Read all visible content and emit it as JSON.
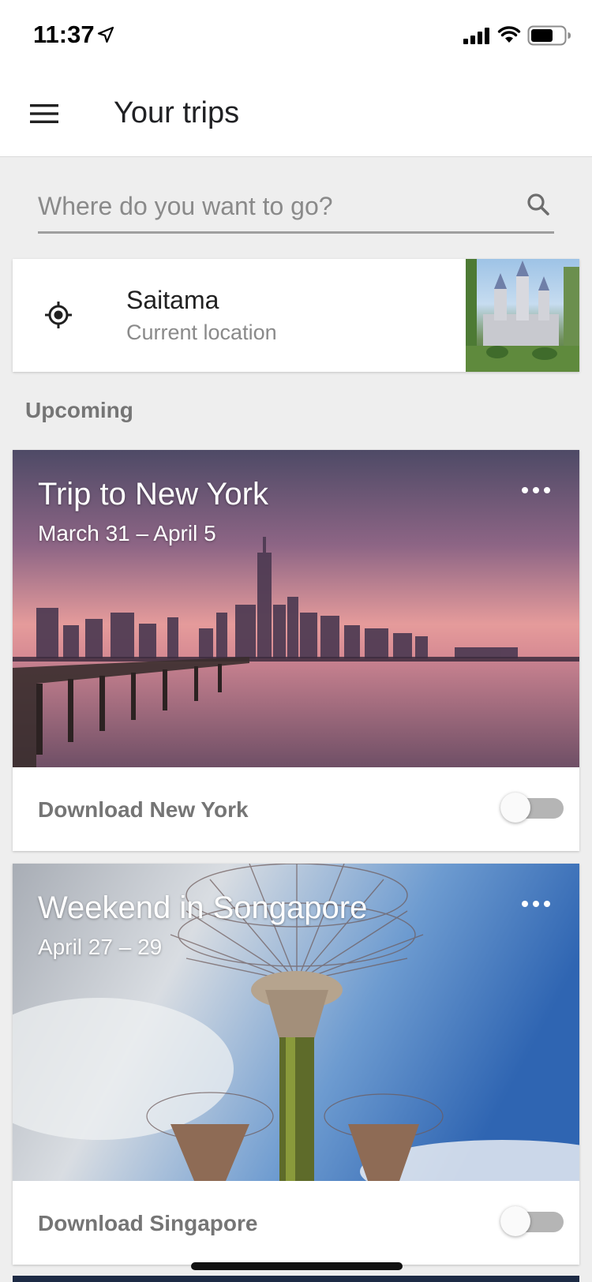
{
  "status_bar": {
    "time": "11:37",
    "icons": [
      "location-arrow-icon",
      "cellular-signal-icon",
      "wifi-icon",
      "battery-icon"
    ]
  },
  "app_bar": {
    "title": "Your trips",
    "menu_icon": "hamburger-menu-icon"
  },
  "search": {
    "placeholder": "Where do you want to go?",
    "value": "",
    "icon": "search-icon"
  },
  "location_card": {
    "name": "Saitama",
    "subtitle": "Current location",
    "icon": "target-icon"
  },
  "section": {
    "label": "Upcoming"
  },
  "trips": [
    {
      "title": "Trip to New York",
      "dates": "March 31 – April 5",
      "download_label": "Download New York",
      "download_enabled": false
    },
    {
      "title": "Weekend in Songapore",
      "dates": "April 27 – 29",
      "download_label": "Download Singapore",
      "download_enabled": false
    }
  ],
  "colors": {
    "background": "#eeeeee",
    "card": "#ffffff",
    "secondary_text": "#757575",
    "toggle_off_track": "#b5b5b5"
  }
}
